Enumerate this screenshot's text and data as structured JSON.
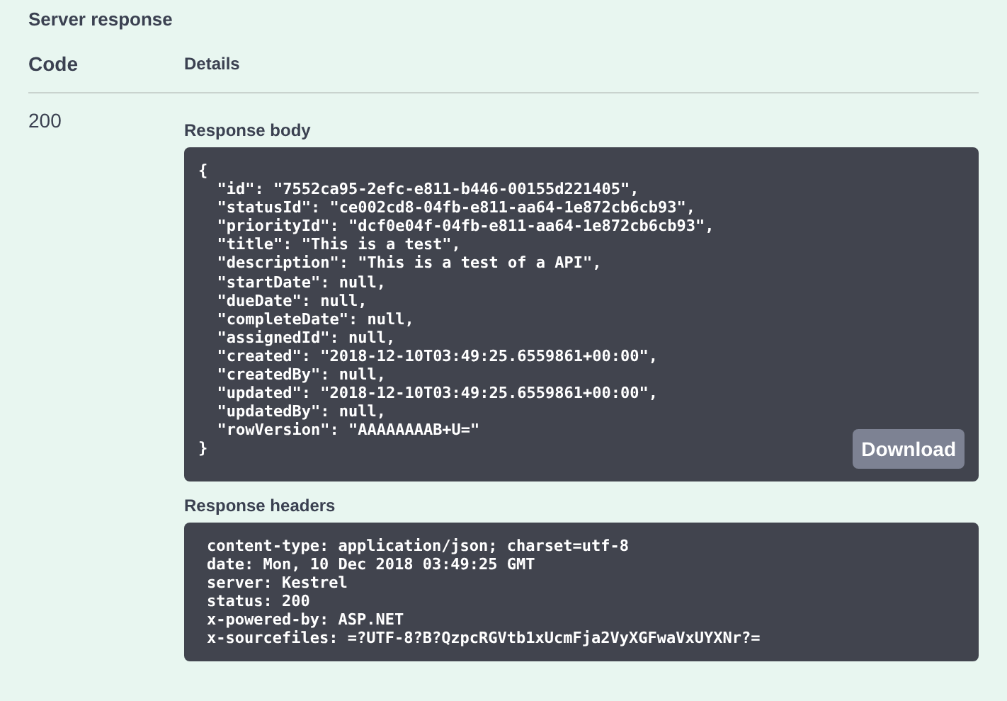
{
  "section_title": "Server response",
  "columns": [
    "Code",
    "Details"
  ],
  "response": {
    "code": "200",
    "body_label": "Response body",
    "body_lines": [
      "{",
      "  \"id\": \"7552ca95-2efc-e811-b446-00155d221405\",",
      "  \"statusId\": \"ce002cd8-04fb-e811-aa64-1e872cb6cb93\",",
      "  \"priorityId\": \"dcf0e04f-04fb-e811-aa64-1e872cb6cb93\",",
      "  \"title\": \"This is a test\",",
      "  \"description\": \"This is a test of a API\",",
      "  \"startDate\": null,",
      "  \"dueDate\": null,",
      "  \"completeDate\": null,",
      "  \"assignedId\": null,",
      "  \"created\": \"2018-12-10T03:49:25.6559861+00:00\",",
      "  \"createdBy\": null,",
      "  \"updated\": \"2018-12-10T03:49:25.6559861+00:00\",",
      "  \"updatedBy\": null,",
      "  \"rowVersion\": \"AAAAAAAAB+U=\"",
      "}"
    ],
    "download_button": "Download",
    "headers_label": "Response headers",
    "header_lines": [
      "content-type: application/json; charset=utf-8",
      "date: Mon, 10 Dec 2018 03:49:25 GMT",
      "server: Kestrel",
      "status: 200",
      "x-powered-by: ASP.NET",
      "x-sourcefiles: =?UTF-8?B?QzpcRGVtb1xUcmFja2VyXGFwaVxUYXNr?="
    ]
  }
}
